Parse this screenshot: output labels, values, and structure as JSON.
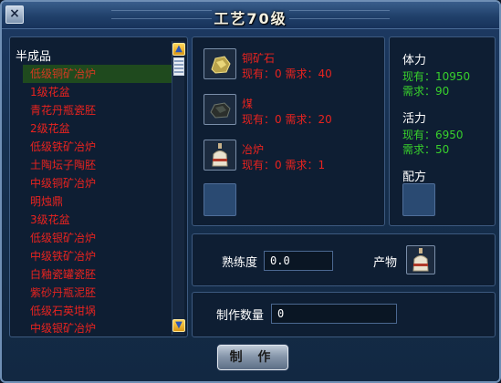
{
  "window": {
    "title": "工艺70级",
    "close_label": "×"
  },
  "list": {
    "header": "半成品",
    "items": [
      {
        "label": "低级铜矿冶炉",
        "selected": true
      },
      {
        "label": "1级花盆"
      },
      {
        "label": "青花丹瓶瓷胚"
      },
      {
        "label": "2级花盆"
      },
      {
        "label": "低级铁矿冶炉"
      },
      {
        "label": "土陶坛子陶胚"
      },
      {
        "label": "中级铜矿冶炉"
      },
      {
        "label": "明烛鼎"
      },
      {
        "label": "3级花盆"
      },
      {
        "label": "低级银矿冶炉"
      },
      {
        "label": "中级铁矿冶炉"
      },
      {
        "label": "白釉瓷罐瓷胚"
      },
      {
        "label": "紫砂丹瓶泥胚"
      },
      {
        "label": "低级石英坩埚"
      },
      {
        "label": "中级银矿冶炉"
      }
    ],
    "scroll_up": "▲",
    "scroll_down": "▼"
  },
  "materials": [
    {
      "name": "铜矿石",
      "qty": "现有：0 需求：40",
      "icon": "copper-ore-icon"
    },
    {
      "name": "煤",
      "qty": "现有：0 需求：20",
      "icon": "coal-icon"
    },
    {
      "name": "冶炉",
      "qty": "现有：0 需求：1",
      "icon": "furnace-icon"
    }
  ],
  "stats": {
    "stamina_title": "体力",
    "stamina_have": "现有：10950",
    "stamina_need": "需求：90",
    "vitality_title": "活力",
    "vitality_have": "现有：6950",
    "vitality_need": "需求：50",
    "recipe_title": "配方"
  },
  "proficiency": {
    "label": "熟练度",
    "value": "0.0",
    "product_label": "产物"
  },
  "quantity": {
    "label": "制作数量",
    "value": "0"
  },
  "make_button": "制 作",
  "colors": {
    "red_text": "#e8231f",
    "green_text": "#38d02c",
    "panel": "#0e1e33",
    "border": "#3d5a80"
  }
}
